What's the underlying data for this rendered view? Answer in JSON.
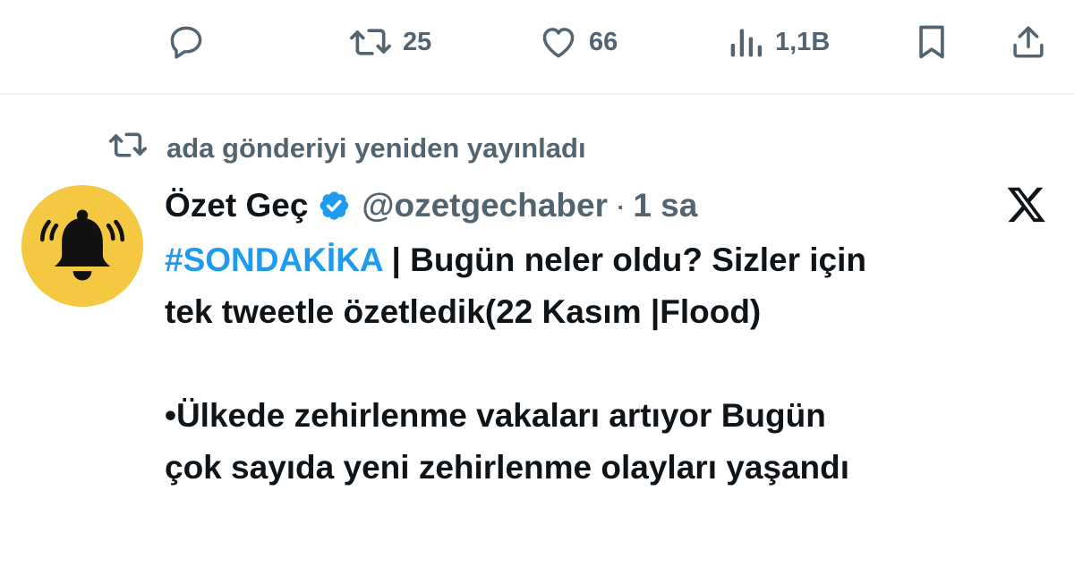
{
  "actions": {
    "reply_icon": "speech-bubble-icon",
    "repost_count": "25",
    "like_count": "66",
    "views_count": "1,1B",
    "bookmark_icon": "bookmark-icon",
    "share_icon": "share-icon"
  },
  "repost_context": {
    "text": "ada gönderiyi yeniden yayınladı"
  },
  "tweet": {
    "author_name": "Özet Geç",
    "handle": "@ozetgechaber",
    "separator": "·",
    "time": "1 sa",
    "hashtag": "#SONDAKİKA",
    "line1_rest": " | Bugün neler oldu? Sizler için",
    "line2": "tek tweetle özetledik(22 Kasım |Flood)",
    "bullet1_line1": "•Ülkede zehirlenme vakaları artıyor Bugün",
    "bullet1_line2": "çok sayıda yeni zehirlenme olayları yaşandı"
  },
  "colors": {
    "accent": "#1d9bf0",
    "muted": "#536471",
    "text": "#0f1419",
    "avatar_bg": "#f5c842"
  }
}
